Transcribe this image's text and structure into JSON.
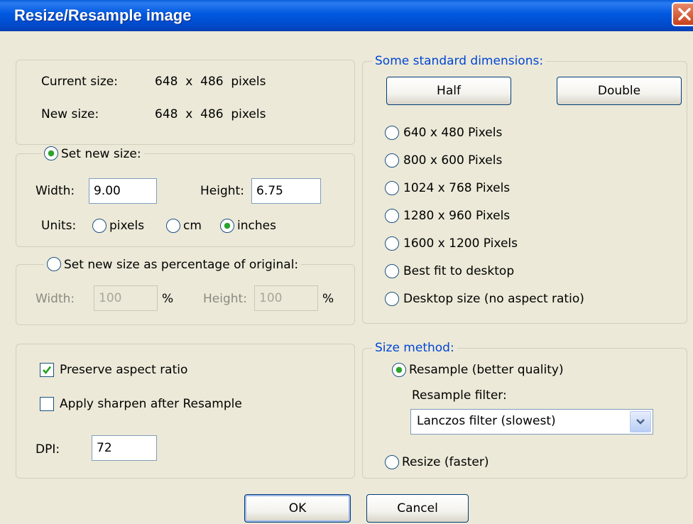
{
  "window": {
    "title": "Resize/Resample image"
  },
  "info": {
    "current_label": "Current size:",
    "current_value": "648  x  486  pixels",
    "new_label": "New size:",
    "new_value": "648  x  486  pixels"
  },
  "set_size": {
    "legend": "Set new size:",
    "selected": true,
    "width_label": "Width:",
    "width_value": "9.00",
    "height_label": "Height:",
    "height_value": "6.75",
    "units_label": "Units:",
    "units": [
      {
        "label": "pixels",
        "selected": false
      },
      {
        "label": "cm",
        "selected": false
      },
      {
        "label": "inches",
        "selected": true
      }
    ]
  },
  "percentage": {
    "legend": "Set new size as percentage of original:",
    "selected": false,
    "width_label": "Width:",
    "width_value": "100",
    "width_unit": "%",
    "height_label": "Height:",
    "height_value": "100",
    "height_unit": "%"
  },
  "options": {
    "preserve_label": "Preserve aspect ratio",
    "preserve_checked": true,
    "sharpen_label": "Apply sharpen after Resample",
    "sharpen_checked": false,
    "dpi_label": "DPI:",
    "dpi_value": "72"
  },
  "standard": {
    "legend": "Some standard dimensions:",
    "half_label": "Half",
    "double_label": "Double",
    "items": [
      "640 x 480 Pixels",
      "800 x 600 Pixels",
      "1024 x 768 Pixels",
      "1280 x 960 Pixels",
      "1600 x 1200 Pixels",
      "Best fit to desktop",
      "Desktop size (no aspect ratio)"
    ]
  },
  "method": {
    "legend": "Size method:",
    "resample_label": "Resample (better quality)",
    "resample_selected": true,
    "filter_label": "Resample filter:",
    "filter_value": "Lanczos filter (slowest)",
    "resize_label": "Resize (faster)",
    "resize_selected": false
  },
  "footer": {
    "ok_label": "OK",
    "cancel_label": "Cancel"
  },
  "colors": {
    "title_bar": "#0058e0",
    "legend_blue": "#0046d5",
    "radio_dot": "#2aa42a"
  }
}
